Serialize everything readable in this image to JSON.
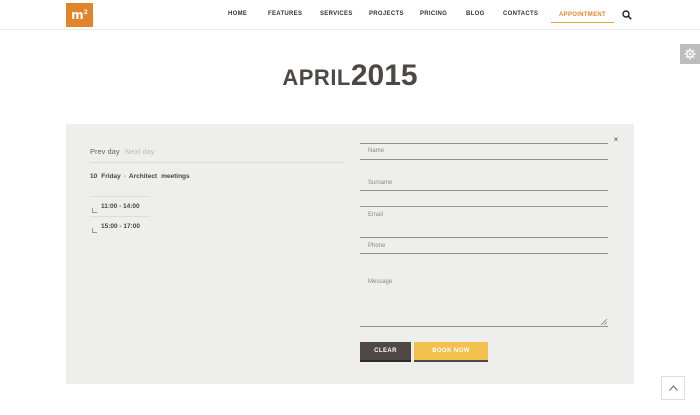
{
  "logo": {
    "text": "m",
    "superscript": "2"
  },
  "nav": {
    "items": [
      "HOME",
      "FEATURES",
      "SERVICES",
      "PROJECTS",
      "PRICING",
      "BLOG",
      "CONTACTS"
    ],
    "appointment": "APPOINTMENT"
  },
  "title": {
    "month": "APRIL",
    "year": "2015"
  },
  "calendar": {
    "prev_day": "Prev day",
    "next_day": "Next day",
    "day_number": "10",
    "day_name": "Friday",
    "separator": "-",
    "event_word1": "Architect",
    "event_word2": "meetings",
    "slots": [
      "11:00 - 14:00",
      "15:00 - 17:00"
    ]
  },
  "form": {
    "close": "×",
    "name_placeholder": "Name",
    "surname_placeholder": "Surname",
    "email_placeholder": "Email",
    "phone_placeholder": "Phone",
    "message_placeholder": "Message",
    "clear_label": "CLEAR",
    "book_label": "BOOK NOW"
  },
  "colors": {
    "accent_orange": "#e0852b",
    "button_yellow": "#f2c14e",
    "button_dark": "#4f4845",
    "panel_bg": "#eeeeec"
  },
  "icons": {
    "search": "search-icon",
    "gear": "gear-icon",
    "close": "close-icon",
    "back_to_top": "chevron-up-icon"
  }
}
